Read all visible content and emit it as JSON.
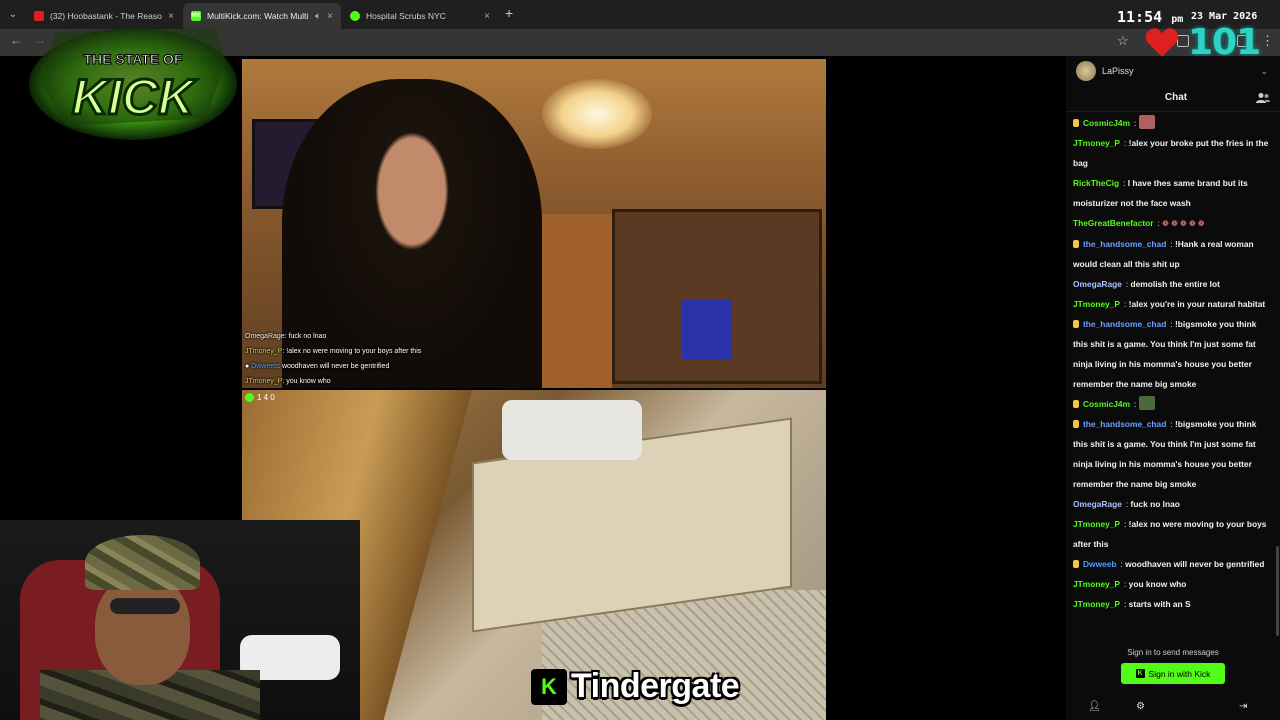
{
  "browser": {
    "tabs": [
      {
        "title": "(32) Hoobastank - The Reason",
        "favicon_color": "#e02020"
      },
      {
        "title": "MultiKick.com: Watch Multi",
        "favicon_color": "#53fc18",
        "favicon_text": "MK",
        "active": true
      },
      {
        "title": "Hospital Scrubs NYC",
        "favicon_color": "#53fc18"
      }
    ],
    "close_glyph": "×",
    "new_tab_glyph": "+"
  },
  "overlay": {
    "clock_time": "11:54",
    "clock_ampm": "pm",
    "date": "23 Mar 2026",
    "viewer_count": "101",
    "heart_color": "#e0201e",
    "count_color": "#2dd3c4"
  },
  "stream1_chat": [
    {
      "user": "OmegaRage",
      "text": "fuck no lnao"
    },
    {
      "user": "JTmoney_P",
      "text": "!alex no were moving to your boys after this"
    },
    {
      "user": "Dwweeb",
      "text": "woodhaven will never be gentrified"
    },
    {
      "user": "JTmoney_P",
      "text": "you know who"
    }
  ],
  "stream2": {
    "viewer_text": "1 4 0"
  },
  "caption": {
    "k": "K",
    "text": "Tindergate"
  },
  "chat_panel": {
    "username": "LaPissy",
    "title": "Chat",
    "messages": [
      {
        "user": "CosmicJ4m",
        "color": "#53fc18",
        "badge": true,
        "text": "",
        "emote": "#b06060"
      },
      {
        "user": "JTmoney_P",
        "color": "#53fc18",
        "text": "!alex your broke put the fries in the bag"
      },
      {
        "user": "RickTheCig",
        "color": "#53fc18",
        "text": "I have thes same brand but its moisturizer not the face wash"
      },
      {
        "user": "TheGreatBenefactor",
        "color": "#53fc18",
        "text": "",
        "hearts": "❁ ❁ ❁ ❁ ❁"
      },
      {
        "user": "the_handsome_chad",
        "color": "#6aa0ff",
        "badge": true,
        "text": "!Hank a real woman would clean all this shit up"
      },
      {
        "user": "OmegaRage",
        "color": "#a9c4ff",
        "text": "demolish the entire lot"
      },
      {
        "user": "JTmoney_P",
        "color": "#53fc18",
        "text": "!alex you're in your natural habitat"
      },
      {
        "user": "the_handsome_chad",
        "color": "#6aa0ff",
        "badge": true,
        "text": "!bigsmoke you think this shit is a game. You think I'm just some fat ninja living in his momma's house you better remember the name big smoke"
      },
      {
        "user": "CosmicJ4m",
        "color": "#53fc18",
        "badge": true,
        "text": "",
        "emote": "#4a6a3a"
      },
      {
        "user": "the_handsome_chad",
        "color": "#6aa0ff",
        "badge": true,
        "text": "!bigsmoke you think this shit is a game. You think I'm just some fat ninja living in his momma's house you better remember the name big smoke"
      },
      {
        "user": "OmegaRage",
        "color": "#a9c4ff",
        "text": "fuck no lnao"
      },
      {
        "user": "JTmoney_P",
        "color": "#53fc18",
        "text": "!alex no were moving to your boys after this"
      },
      {
        "user": "Dwweeb",
        "color": "#4aa0ff",
        "badge": true,
        "text": "woodhaven will never be gentrified"
      },
      {
        "user": "JTmoney_P",
        "color": "#53fc18",
        "text": "you know who"
      },
      {
        "user": "JTmoney_P",
        "color": "#53fc18",
        "text": "starts with an S"
      }
    ],
    "signin_text": "Sign in to send messages",
    "signin_button": "Sign in with Kick",
    "accent": "#53fc18"
  }
}
